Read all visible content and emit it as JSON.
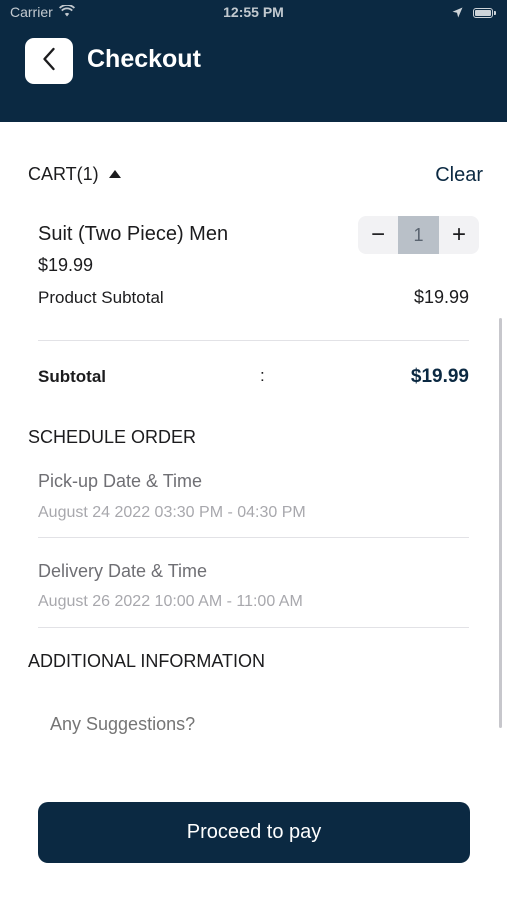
{
  "status_bar": {
    "carrier": "Carrier",
    "time": "12:55 PM"
  },
  "header": {
    "title": "Checkout"
  },
  "cart": {
    "title": "CART(1)",
    "clear_label": "Clear",
    "items": [
      {
        "name": "Suit (Two Piece) Men",
        "price": "$19.99",
        "quantity": "1",
        "decrement_label": "−",
        "increment_label": "+",
        "product_subtotal_label": "Product Subtotal",
        "product_subtotal_value": "$19.99"
      }
    ],
    "subtotal_label": "Subtotal",
    "subtotal_separator": ":",
    "subtotal_value": "$19.99"
  },
  "schedule": {
    "title": "SCHEDULE ORDER",
    "pickup_label": "Pick-up Date & Time",
    "pickup_value": "August 24 2022 03:30 PM - 04:30 PM",
    "delivery_label": "Delivery Date & Time",
    "delivery_value": "August 26 2022 10:00 AM - 11:00 AM"
  },
  "additional": {
    "title": "ADDITIONAL INFORMATION",
    "placeholder": "Any Suggestions?"
  },
  "actions": {
    "pay_label": "Proceed to pay"
  },
  "colors": {
    "primary": "#0b2942",
    "stepper_value_bg": "#b9c0c8",
    "muted_text": "#a8a8ad"
  },
  "icons": {
    "back": "chevron-left-icon",
    "wifi": "wifi-icon",
    "location": "location-arrow-icon",
    "battery": "battery-icon",
    "cart_toggle": "caret-up-icon"
  }
}
